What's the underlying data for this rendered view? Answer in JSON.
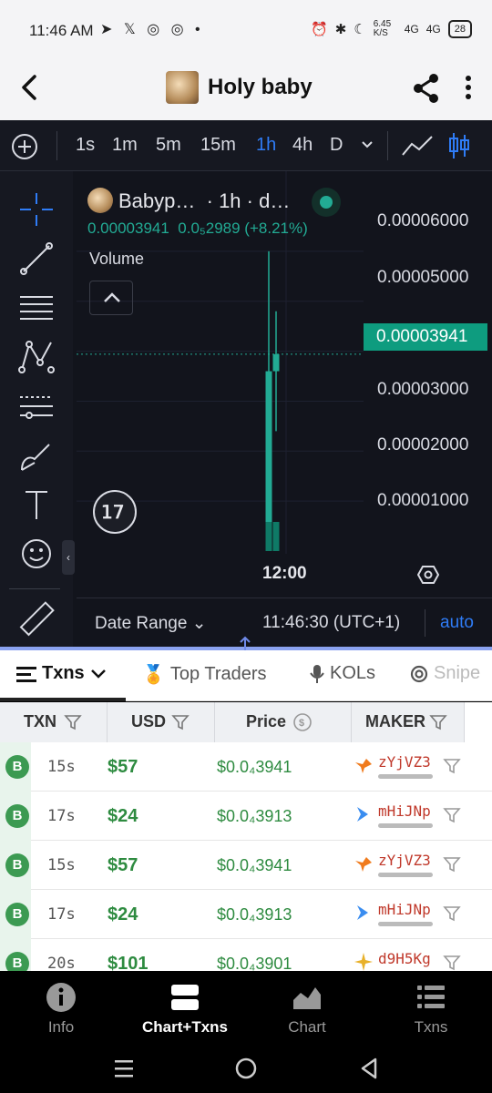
{
  "status_bar": {
    "time": "11:46 AM",
    "speed": "6.45 K/S",
    "signal1": "4G",
    "signal2": "4G",
    "battery": "28"
  },
  "header": {
    "title": "Holy baby"
  },
  "toolbar": {
    "intervals": [
      "1s",
      "1m",
      "5m",
      "15m",
      "1h",
      "4h",
      "D"
    ],
    "active_interval": "1h"
  },
  "chart_legend": {
    "symbol": "Babyp…",
    "interval_suffix": "· 1h · d…",
    "price": "0.00003941",
    "change": "0.0₅2989 (+8.21%)",
    "volume_label": "Volume"
  },
  "chart_data": {
    "type": "candlestick",
    "y_ticks": [
      "0.00006000",
      "0.00005000",
      "0.00003941",
      "0.00003000",
      "0.00002000",
      "0.00001000"
    ],
    "ylim": [
      0.0,
      6.6e-05
    ],
    "current_price": "0.00003941",
    "x_tick": "12:00",
    "candles": [
      {
        "open": 0.0,
        "high": 6e-05,
        "low": 0.0,
        "close": 3.6e-05,
        "color": "up"
      },
      {
        "open": 3.6e-05,
        "high": 4.8e-05,
        "low": 2.4e-05,
        "close": 3.94e-05,
        "color": "up"
      }
    ]
  },
  "date_bar": {
    "date_range": "Date Range",
    "clock": "11:46:30 (UTC+1)",
    "auto": "auto"
  },
  "tabs": [
    {
      "label": "Txns"
    },
    {
      "label": "Top Traders"
    },
    {
      "label": "KOLs"
    },
    {
      "label": "Snipe"
    }
  ],
  "table": {
    "headers": [
      "TXN",
      "USD",
      "Price",
      "MAKER"
    ],
    "rows": [
      {
        "type": "B",
        "age": "15s",
        "usd": "$57",
        "price": "$0.0₄3941",
        "maker": "zYjVZ3",
        "maker_icon": "bird-icon"
      },
      {
        "type": "B",
        "age": "17s",
        "usd": "$24",
        "price": "$0.0₄3913",
        "maker": "mHiJNp",
        "maker_icon": "arrow-icon"
      },
      {
        "type": "B",
        "age": "15s",
        "usd": "$57",
        "price": "$0.0₄3941",
        "maker": "zYjVZ3",
        "maker_icon": "bird-icon"
      },
      {
        "type": "B",
        "age": "17s",
        "usd": "$24",
        "price": "$0.0₄3913",
        "maker": "mHiJNp",
        "maker_icon": "arrow-icon"
      },
      {
        "type": "B",
        "age": "20s",
        "usd": "$101",
        "price": "$0.0₄3901",
        "maker": "d9H5Kg",
        "maker_icon": "sparkle-icon"
      }
    ]
  },
  "bottom_nav": [
    {
      "label": "Info"
    },
    {
      "label": "Chart+Txns"
    },
    {
      "label": "Chart"
    },
    {
      "label": "Txns"
    }
  ],
  "colors": {
    "up": "#22ab94",
    "accent": "#2f7cf6",
    "buy": "#3c9a52"
  }
}
